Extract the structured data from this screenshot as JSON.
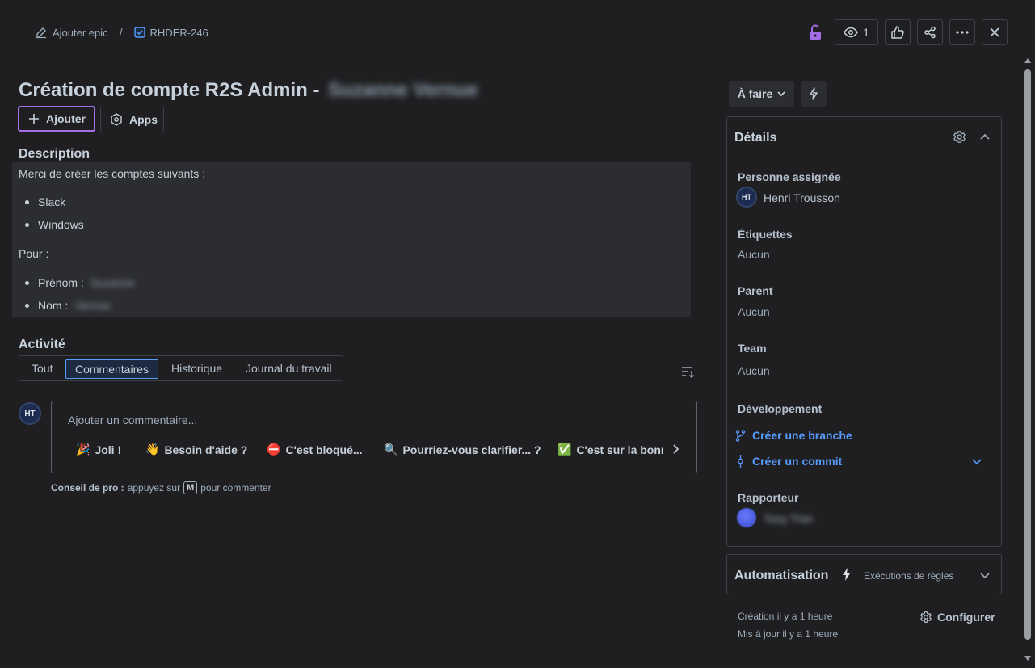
{
  "breadcrumb": {
    "parent_label": "Ajouter epic",
    "separator": "/",
    "issue_key": "RHDER-246"
  },
  "top_actions": {
    "watchers_count": "1"
  },
  "issue": {
    "title": "Création de compte R2S Admin -",
    "title_name": "Suzanne Vernue",
    "add_label": "Ajouter",
    "apps_label": "Apps"
  },
  "description": {
    "heading": "Description",
    "intro": "Merci de créer les comptes suivants :",
    "accounts": [
      "Slack",
      "Windows"
    ],
    "pour": "Pour :",
    "firstname_label": "Prénom :",
    "firstname_value": "Suzanne",
    "lastname_label": "Nom :",
    "lastname_value": "Vernue"
  },
  "activity": {
    "heading": "Activité",
    "tabs": [
      "Tout",
      "Commentaires",
      "Historique",
      "Journal du travail"
    ],
    "active_tab": "Commentaires",
    "avatar_initials": "HT",
    "comment_placeholder": "Ajouter un commentaire...",
    "quick_replies": [
      {
        "emoji": "🎉",
        "label": "Joli !"
      },
      {
        "emoji": "👋",
        "label": "Besoin d'aide ?"
      },
      {
        "emoji": "⛔",
        "label": "C'est bloqué..."
      },
      {
        "emoji": "🔍",
        "label": "Pourriez-vous clarifier... ?"
      },
      {
        "emoji": "✅",
        "label": "C'est sur la bonne voie"
      }
    ],
    "tip_label": "Conseil de pro :",
    "tip_before": "appuyez sur",
    "tip_key": "M",
    "tip_after": "pour commenter"
  },
  "status": {
    "label": "À faire"
  },
  "details": {
    "heading": "Détails",
    "assignee_label": "Personne assignée",
    "assignee_initials": "HT",
    "assignee_name": "Henri Trousson",
    "labels_label": "Étiquettes",
    "labels_value": "Aucun",
    "parent_label": "Parent",
    "parent_value": "Aucun",
    "team_label": "Team",
    "team_value": "Aucun",
    "dev_label": "Développement",
    "create_branch": "Créer une branche",
    "create_commit": "Créer un commit",
    "reporter_label": "Rapporteur",
    "reporter_name": "Tony Tran"
  },
  "automation": {
    "heading": "Automatisation",
    "rule_runs": "Exécutions de règles"
  },
  "footer": {
    "created": "Création il y a 1 heure",
    "updated": "Mis à jour il y a 1 heure",
    "configure": "Configurer"
  },
  "colors": {
    "background": "#1f1f21",
    "accent_blue": "#579dff",
    "focus_purple": "#a46ee6"
  }
}
